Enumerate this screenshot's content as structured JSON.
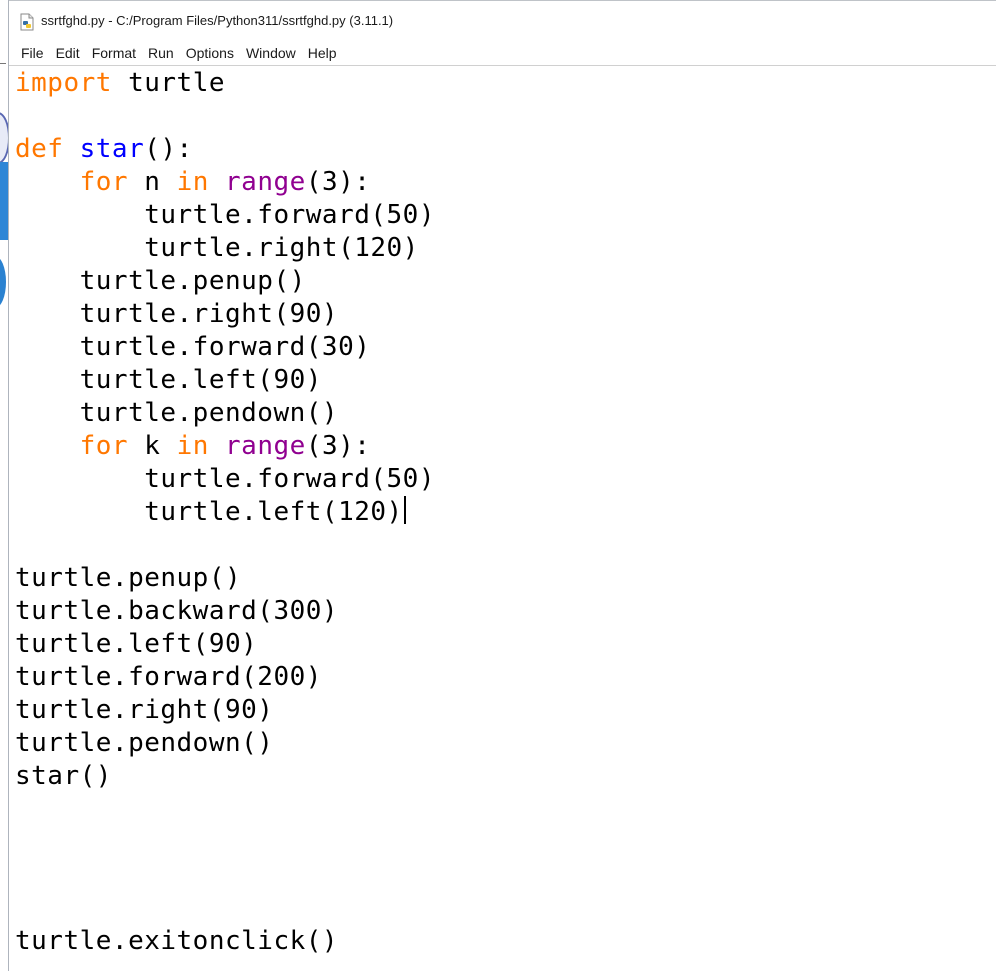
{
  "window": {
    "title": "ssrtfghd.py - C:/Program Files/Python311/ssrtfghd.py (3.11.1)"
  },
  "menu": [
    "File",
    "Edit",
    "Format",
    "Run",
    "Options",
    "Window",
    "Help"
  ],
  "colors": {
    "keyword": "#ff7700",
    "definition": "#0000ff",
    "builtin": "#900090",
    "text": "#000000"
  },
  "code": [
    [
      {
        "t": "import",
        "c": "kw"
      },
      {
        "t": " turtle"
      }
    ],
    [],
    [
      {
        "t": "def",
        "c": "kw"
      },
      {
        "t": " "
      },
      {
        "t": "star",
        "c": "fn"
      },
      {
        "t": "():"
      }
    ],
    [
      {
        "t": "    "
      },
      {
        "t": "for",
        "c": "kw"
      },
      {
        "t": " n "
      },
      {
        "t": "in",
        "c": "kw"
      },
      {
        "t": " "
      },
      {
        "t": "range",
        "c": "bi"
      },
      {
        "t": "(3):"
      }
    ],
    [
      {
        "t": "        turtle.forward(50)"
      }
    ],
    [
      {
        "t": "        turtle.right(120)"
      }
    ],
    [
      {
        "t": "    turtle.penup()"
      }
    ],
    [
      {
        "t": "    turtle.right(90)"
      }
    ],
    [
      {
        "t": "    turtle.forward(30)"
      }
    ],
    [
      {
        "t": "    turtle.left(90)"
      }
    ],
    [
      {
        "t": "    turtle.pendown()"
      }
    ],
    [
      {
        "t": "    "
      },
      {
        "t": "for",
        "c": "kw"
      },
      {
        "t": " k "
      },
      {
        "t": "in",
        "c": "kw"
      },
      {
        "t": " "
      },
      {
        "t": "range",
        "c": "bi"
      },
      {
        "t": "(3):"
      }
    ],
    [
      {
        "t": "        turtle.forward(50)"
      }
    ],
    [
      {
        "t": "        turtle.left(120)"
      },
      {
        "caret": true
      }
    ],
    [],
    [
      {
        "t": "turtle.penup()"
      }
    ],
    [
      {
        "t": "turtle.backward(300)"
      }
    ],
    [
      {
        "t": "turtle.left(90)"
      }
    ],
    [
      {
        "t": "turtle.forward(200)"
      }
    ],
    [
      {
        "t": "turtle.right(90)"
      }
    ],
    [
      {
        "t": "turtle.pendown()"
      }
    ],
    [
      {
        "t": "star()"
      }
    ],
    [],
    [],
    [],
    [],
    [
      {
        "t": "turtle.exitonclick()"
      }
    ]
  ]
}
